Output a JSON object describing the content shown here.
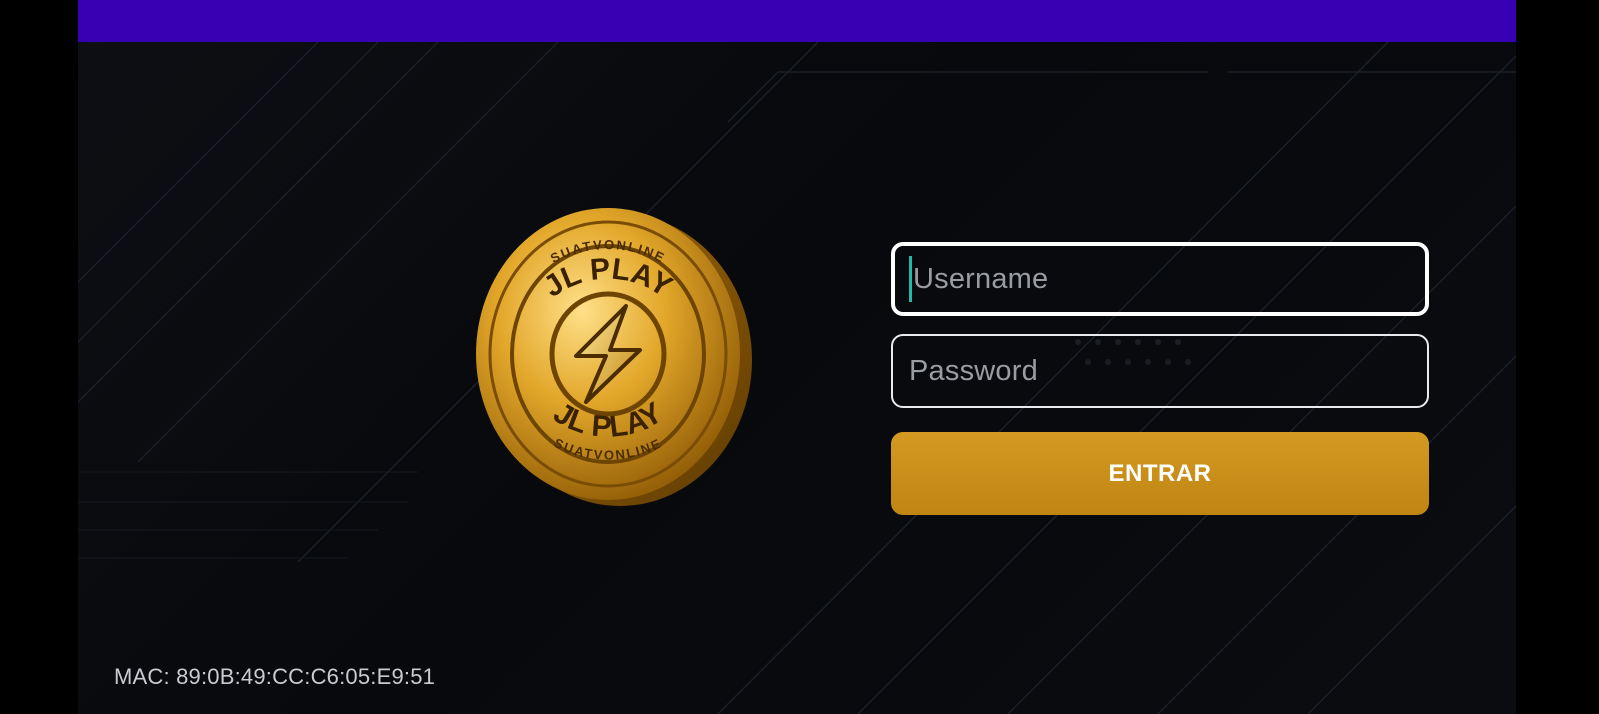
{
  "app": {
    "logo_text_top": "SUATVONLINE",
    "logo_brand_top": "JL PLAY",
    "logo_brand_bottom": "JL PLAY",
    "logo_text_bottom": "SUATVONLINE"
  },
  "login": {
    "username_placeholder": "Username",
    "password_placeholder": "Password",
    "submit_label": "ENTRAR"
  },
  "footer": {
    "mac_label": "MAC: 89:0B:49:CC:C6:05:E9:51"
  },
  "colors": {
    "topbar": "#3700b3",
    "background": "#07090c",
    "accent_gold": "#c9901a",
    "caret": "#29b6a8"
  },
  "icons": [
    "lightning-bolt-icon"
  ]
}
